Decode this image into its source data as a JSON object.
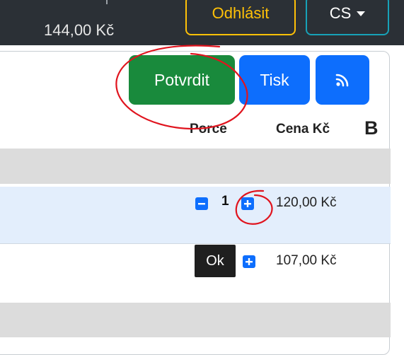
{
  "header": {
    "balance": "144,00 Kč",
    "logout_label": "Odhlásit",
    "language_label": "CS"
  },
  "toolbar": {
    "confirm_label": "Potvrdit",
    "print_label": "Tisk",
    "rss_icon": "rss-icon"
  },
  "table": {
    "columns": [
      "Porce",
      "Cena Kč",
      "B"
    ],
    "rows": [
      {
        "quantity": "1",
        "price": "120,00 Kč"
      },
      {
        "status": "Ok",
        "price": "107,00 Kč"
      }
    ]
  },
  "colors": {
    "topbar": "#2b3036",
    "logout_border": "#ffc107",
    "language_border": "#17a2b8",
    "confirm": "#198a3c",
    "primary": "#0d6efd",
    "annotation": "#e0141e"
  }
}
